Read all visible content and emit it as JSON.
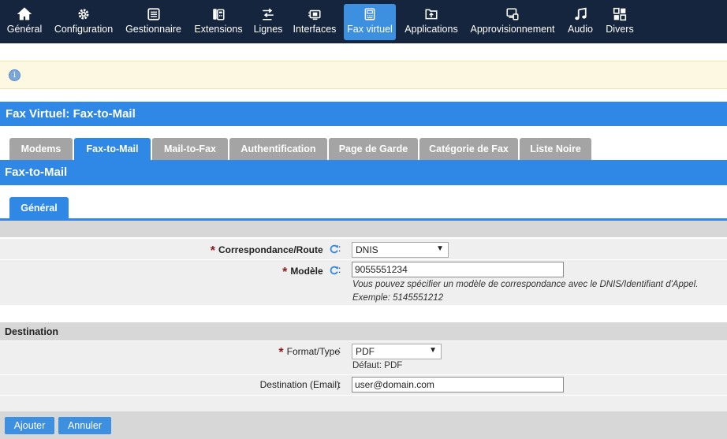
{
  "nav": {
    "items": [
      {
        "label": "Général",
        "icon": "home-icon"
      },
      {
        "label": "Configuration",
        "icon": "gear-icon"
      },
      {
        "label": "Gestionnaire",
        "icon": "list-icon"
      },
      {
        "label": "Extensions",
        "icon": "phone-icon"
      },
      {
        "label": "Lignes",
        "icon": "route-icon"
      },
      {
        "label": "Interfaces",
        "icon": "interface-icon"
      },
      {
        "label": "Fax virtuel",
        "icon": "fax-icon"
      },
      {
        "label": "Applications",
        "icon": "apps-icon"
      },
      {
        "label": "Approvisionnement",
        "icon": "provisioning-icon"
      },
      {
        "label": "Audio",
        "icon": "music-icon"
      },
      {
        "label": "Divers",
        "icon": "misc-icon"
      }
    ],
    "active": "Fax virtuel"
  },
  "info": {
    "icon": "info-icon",
    "glyph": "i"
  },
  "page_title": "Fax Virtuel:  Fax-to-Mail",
  "tabs": [
    "Modems",
    "Fax-to-Mail",
    "Mail-to-Fax",
    "Authentification",
    "Page de Garde",
    "Catégorie de Fax",
    "Liste Noire"
  ],
  "active_tab": "Fax-to-Mail",
  "section_title": "Fax-to-Mail",
  "subtab": "Général",
  "form": {
    "route_label": "Correspondance/Route",
    "route_value": "DNIS",
    "model_label": "Modèle",
    "model_value": "9055551234",
    "model_help1": "Vous pouvez spécifier un modèle de correspondance avec le DNIS/Identifiant d'Appel.",
    "model_help2": "Exemple: 5145551212",
    "destination_header": "Destination",
    "format_label": "Format/Type",
    "format_value": "PDF",
    "format_default": "Défaut: PDF",
    "email_label": "Destination (Email)",
    "email_value": "user@domain.com",
    "colon": ":",
    "required_mark": "*",
    "arrow": "▼"
  },
  "buttons": {
    "add": "Ajouter",
    "cancel": "Annuler"
  },
  "colors": {
    "nav_bg": "#14253d",
    "accent": "#2f87e6",
    "required": "#8a1a1a"
  }
}
